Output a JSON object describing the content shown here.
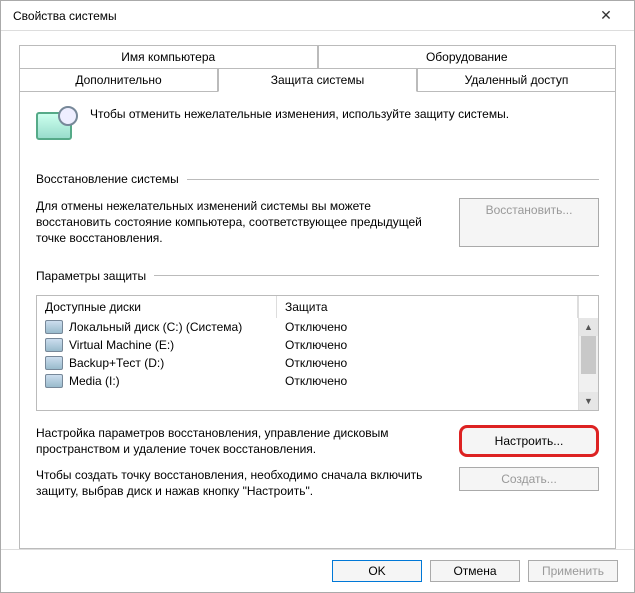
{
  "window": {
    "title": "Свойства системы"
  },
  "tabs_top": [
    "Имя компьютера",
    "Оборудование"
  ],
  "tabs_bottom": [
    "Дополнительно",
    "Защита системы",
    "Удаленный доступ"
  ],
  "intro": "Чтобы отменить нежелательные изменения, используйте защиту системы.",
  "sections": {
    "restore_title": "Восстановление системы",
    "restore_desc": "Для отмены нежелательных изменений системы вы можете восстановить состояние компьютера, соответствующее предыдущей точке восстановления.",
    "restore_button": "Восстановить...",
    "params_title": "Параметры защиты"
  },
  "drives": {
    "col_name": "Доступные диски",
    "col_prot": "Защита",
    "rows": [
      {
        "name": "Локальный диск (C:) (Система)",
        "prot": "Отключено"
      },
      {
        "name": "Virtual Machine (E:)",
        "prot": "Отключено"
      },
      {
        "name": "Backup+Тест (D:)",
        "prot": "Отключено"
      },
      {
        "name": "Media (I:)",
        "prot": "Отключено"
      }
    ]
  },
  "configure": {
    "desc": "Настройка параметров восстановления, управление дисковым пространством и удаление точек восстановления.",
    "button": "Настроить..."
  },
  "create": {
    "desc": "Чтобы создать точку восстановления, необходимо сначала включить защиту, выбрав диск и нажав кнопку \"Настроить\".",
    "button": "Создать..."
  },
  "footer": {
    "ok": "OK",
    "cancel": "Отмена",
    "apply": "Применить"
  }
}
